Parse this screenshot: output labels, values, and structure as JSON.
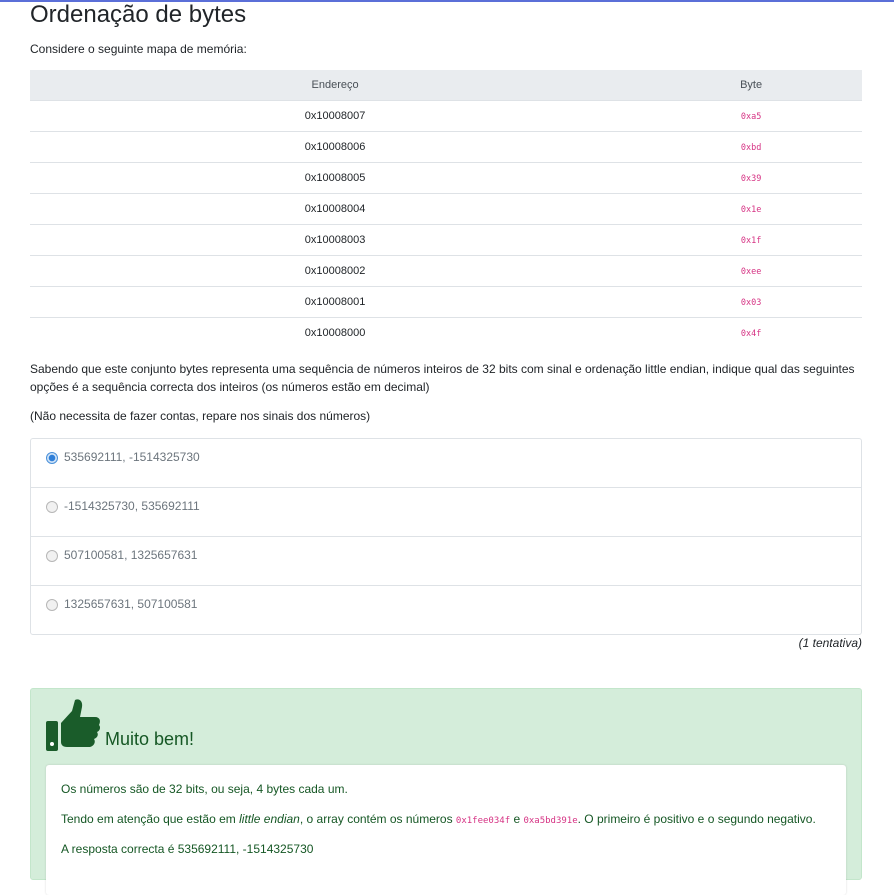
{
  "page": {
    "title": "Ordenação de bytes",
    "intro": "Considere o seguinte mapa de memória:"
  },
  "memory_table": {
    "headers": {
      "address": "Endereço",
      "byte": "Byte"
    },
    "rows": [
      {
        "address": "0x10008007",
        "byte": "0xa5"
      },
      {
        "address": "0x10008006",
        "byte": "0xbd"
      },
      {
        "address": "0x10008005",
        "byte": "0x39"
      },
      {
        "address": "0x10008004",
        "byte": "0x1e"
      },
      {
        "address": "0x10008003",
        "byte": "0x1f"
      },
      {
        "address": "0x10008002",
        "byte": "0xee"
      },
      {
        "address": "0x10008001",
        "byte": "0x03"
      },
      {
        "address": "0x10008000",
        "byte": "0x4f"
      }
    ]
  },
  "question": {
    "text": "Sabendo que este conjunto bytes representa uma sequência de números inteiros de 32 bits com sinal e ordenação little endian, indique qual das seguintes opções é a sequência correcta dos inteiros (os números estão em decimal)",
    "hint": "(Não necessita de fazer contas, repare nos sinais dos números)"
  },
  "options": [
    {
      "label": "535692111, -1514325730",
      "selected": true
    },
    {
      "label": "-1514325730, 535692111",
      "selected": false
    },
    {
      "label": "507100581, 1325657631",
      "selected": false
    },
    {
      "label": "1325657631, 507100581",
      "selected": false
    }
  ],
  "attempts": "(1 tentativa)",
  "feedback": {
    "title": "Muito bem!",
    "icon": "thumbs-up-icon",
    "line1": "Os números são de 32 bits, ou seja, 4 bytes cada um.",
    "line2_pre": "Tendo em atenção que estão em ",
    "line2_em": "little endian",
    "line2_mid": ", o array contém os números ",
    "line2_code1": "0x1fee034f",
    "line2_and": " e ",
    "line2_code2": "0xa5bd391e",
    "line2_post": ". O primeiro é positivo e o segundo negativo.",
    "line3": "A resposta correcta é 535692111, -1514325730"
  },
  "colors": {
    "accent": "#5b6fd8",
    "code": "#d63384",
    "success_bg": "#d4edda",
    "success_text": "#155724"
  }
}
